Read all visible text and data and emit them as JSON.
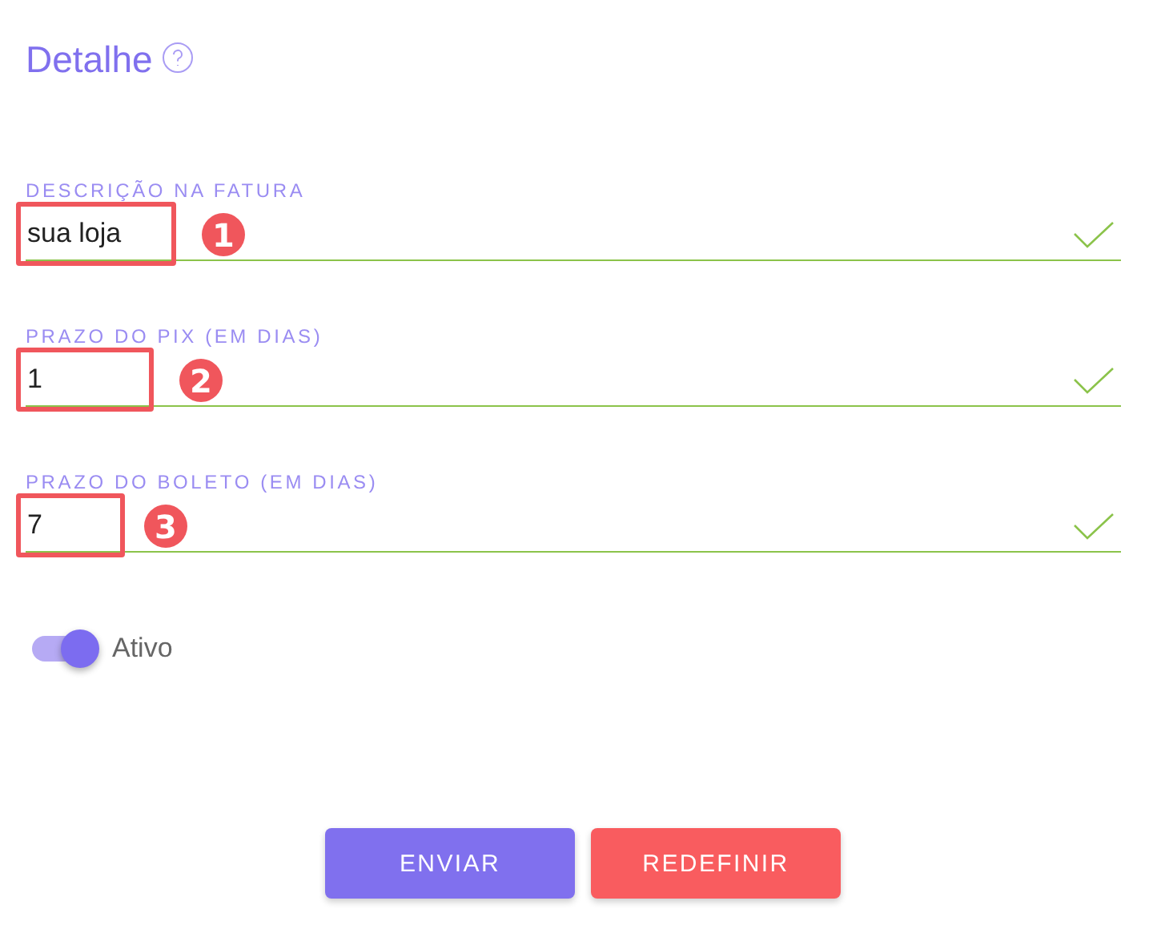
{
  "title": "Detalhe",
  "fields": [
    {
      "label": "DESCRIÇÃO NA FATURA",
      "value": "sua loja",
      "valid": true,
      "marker": "1"
    },
    {
      "label": "PRAZO DO PIX (EM DIAS)",
      "value": "1",
      "valid": true,
      "marker": "2"
    },
    {
      "label": "PRAZO DO BOLETO (EM DIAS)",
      "value": "7",
      "valid": true,
      "marker": "3"
    }
  ],
  "toggle": {
    "label": "Ativo",
    "on": true
  },
  "buttons": [
    {
      "label": "ENVIAR",
      "kind": "primary"
    },
    {
      "label": "REDEFINIR",
      "kind": "reset"
    }
  ]
}
